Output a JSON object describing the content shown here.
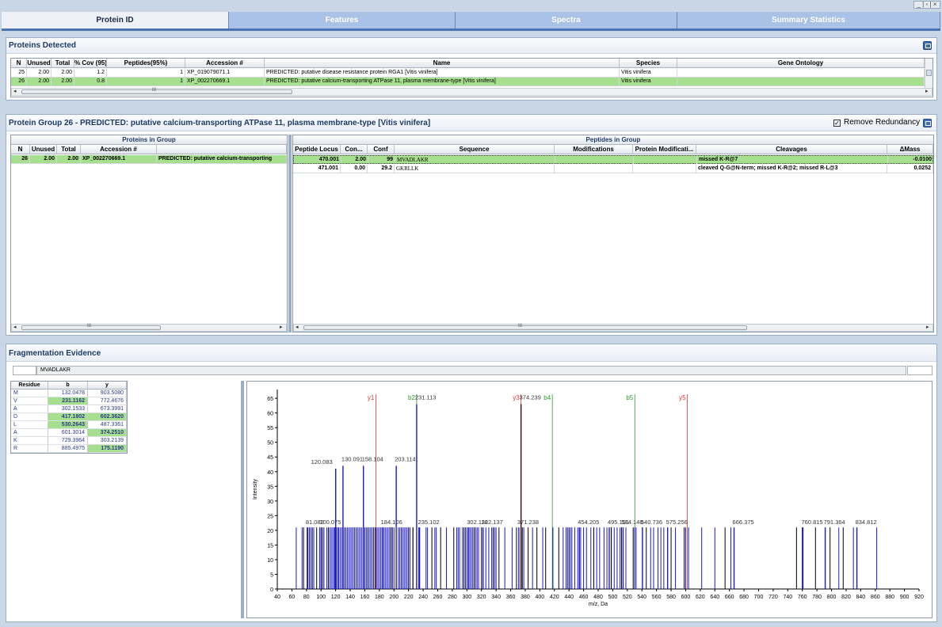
{
  "window": {
    "controls": "_ | ▫ | ×"
  },
  "tabs": [
    {
      "label": "Protein ID",
      "active": true
    },
    {
      "label": "Features",
      "active": false
    },
    {
      "label": "Spectra",
      "active": false
    },
    {
      "label": "Summary Statistics",
      "active": false
    }
  ],
  "proteins_detected": {
    "title": "Proteins Detected",
    "columns": [
      "N",
      "Unused",
      "Total",
      "% Cov (95)",
      "Peptides(95%)",
      "Accession #",
      "Name",
      "Species",
      "Gene Ontology"
    ],
    "rows": [
      {
        "n": "25",
        "unused": "2.00",
        "total": "2.00",
        "cov": "1.2",
        "peptides": "1",
        "accession": "XP_019079071.1",
        "name": "PREDICTED: putative disease resistance protein RGA1 [Vitis vinifera]",
        "species": "Vitis vinifera",
        "go": "",
        "selected": false
      },
      {
        "n": "26",
        "unused": "2.00",
        "total": "2.00",
        "cov": "0.8",
        "peptides": "1",
        "accession": "XP_002270669.1",
        "name": "PREDICTED: putative calcium-transporting ATPase 11, plasma membrane-type [Vitis vinifera]",
        "species": "Vitis vinifera",
        "go": "",
        "selected": true
      }
    ],
    "scroll_marker": "III"
  },
  "protein_group": {
    "title": "Protein Group 26 - PREDICTED: putative calcium-transporting ATPase 11, plasma membrane-type [Vitis vinifera]",
    "remove_redundancy_label": "Remove Redundancy",
    "remove_redundancy_checked": true,
    "proteins_in_group": {
      "header": "Proteins in Group",
      "columns": [
        "N",
        "Unused",
        "Total",
        "Accession #",
        ""
      ],
      "rows": [
        {
          "n": "26",
          "unused": "2.00",
          "total": "2.00",
          "accession": "XP_002270669.1",
          "name": "PREDICTED: putative calcium-transporting"
        }
      ],
      "scroll_marker": "III"
    },
    "peptides_in_group": {
      "header": "Peptides in Group",
      "columns": [
        "Peptide Locus",
        "Con...",
        "Conf",
        "Sequence",
        "Modifications",
        "Protein Modificati...",
        "Cleavages",
        "ΔMass"
      ],
      "rows": [
        {
          "locus": "470.001",
          "contrib": "2.00",
          "conf": "99",
          "sequence": "MVADLAKR",
          "mods": "",
          "protmods": "",
          "cleavages": "missed K-R@7",
          "dmass": "-0.0100",
          "selected": true
        },
        {
          "locus": "471.001",
          "contrib": "0.00",
          "conf": "29.2",
          "sequence": "GKRLLK",
          "mods": "",
          "protmods": "",
          "cleavages": "cleaved Q-G@N-term; missed K-R@2; missed R-L@3",
          "dmass": "0.0252",
          "selected": false
        }
      ],
      "scroll_marker": "III"
    }
  },
  "fragmentation": {
    "title": "Fragmentation Evidence",
    "sequence": "MVADLAKR",
    "table": {
      "columns": [
        "Residue",
        "b",
        "y"
      ],
      "rows": [
        {
          "residue": "M",
          "b": "132.0478",
          "y": "903.5080",
          "b_hl": false,
          "y_hl": false
        },
        {
          "residue": "V",
          "b": "231.1162",
          "y": "772.4676",
          "b_hl": true,
          "y_hl": false
        },
        {
          "residue": "A",
          "b": "302.1533",
          "y": "673.3991",
          "b_hl": false,
          "y_hl": false
        },
        {
          "residue": "D",
          "b": "417.1802",
          "y": "602.3620",
          "b_hl": true,
          "y_hl": true
        },
        {
          "residue": "L",
          "b": "530.2643",
          "y": "487.3361",
          "b_hl": true,
          "y_hl": false
        },
        {
          "residue": "A",
          "b": "601.3014",
          "y": "374.2510",
          "b_hl": false,
          "y_hl": true
        },
        {
          "residue": "K",
          "b": "729.3964",
          "y": "303.2139",
          "b_hl": false,
          "y_hl": false
        },
        {
          "residue": "R",
          "b": "885.4975",
          "y": "175.1190",
          "b_hl": false,
          "y_hl": true
        }
      ]
    }
  },
  "chart_data": {
    "type": "bar",
    "xlabel": "m/z, Da",
    "ylabel": "Intensity",
    "xlim": [
      40,
      920
    ],
    "ylim": [
      0,
      68
    ],
    "xticks": [
      40,
      60,
      80,
      100,
      120,
      140,
      160,
      180,
      200,
      220,
      240,
      260,
      280,
      300,
      320,
      340,
      360,
      380,
      400,
      420,
      440,
      460,
      480,
      500,
      520,
      540,
      560,
      580,
      600,
      620,
      640,
      660,
      680,
      700,
      720,
      740,
      760,
      780,
      800,
      820,
      840,
      860,
      880,
      900,
      920
    ],
    "yticks": [
      0,
      5,
      10,
      15,
      20,
      25,
      30,
      35,
      40,
      45,
      50,
      55,
      60,
      65
    ],
    "colors": {
      "peak": "#1a1acc",
      "y_ion": "#e03030",
      "b_ion": "#2a9a2a",
      "unmatched": "#000000"
    },
    "labeled_peaks": [
      {
        "mz": 81.083,
        "intensity": 21,
        "label": "81.083"
      },
      {
        "mz": 100.075,
        "intensity": 21,
        "label": "100.075"
      },
      {
        "mz": 120.083,
        "intensity": 41,
        "label": "120.083"
      },
      {
        "mz": 130.091,
        "intensity": 42,
        "label": "130.091"
      },
      {
        "mz": 158.104,
        "intensity": 42,
        "label": "158.104"
      },
      {
        "mz": 184.106,
        "intensity": 21,
        "label": "184.106"
      },
      {
        "mz": 203.114,
        "intensity": 42,
        "label": "203.114"
      },
      {
        "mz": 231.113,
        "intensity": 63,
        "label": "231.113"
      },
      {
        "mz": 235.102,
        "intensity": 21,
        "label": "235.102"
      },
      {
        "mz": 302.116,
        "intensity": 21,
        "label": "302.116"
      },
      {
        "mz": 322.137,
        "intensity": 21,
        "label": "322.137"
      },
      {
        "mz": 371.238,
        "intensity": 21,
        "label": "371.238"
      },
      {
        "mz": 374.239,
        "intensity": 63,
        "label": "374.239"
      },
      {
        "mz": 454.205,
        "intensity": 21,
        "label": "454.205"
      },
      {
        "mz": 495.191,
        "intensity": 21,
        "label": "495.191"
      },
      {
        "mz": 514.148,
        "intensity": 21,
        "label": "514.148"
      },
      {
        "mz": 540.736,
        "intensity": 21,
        "label": "540.736"
      },
      {
        "mz": 575.256,
        "intensity": 21,
        "label": "575.256"
      },
      {
        "mz": 666.375,
        "intensity": 21,
        "label": "666.375"
      },
      {
        "mz": 760.815,
        "intensity": 21,
        "label": "760.815"
      },
      {
        "mz": 791.364,
        "intensity": 21,
        "label": "791.364"
      },
      {
        "mz": 834.812,
        "intensity": 21,
        "label": "834.812"
      }
    ],
    "ion_markers": [
      {
        "label": "y1",
        "mz": 175.119,
        "kind": "y"
      },
      {
        "label": "b2",
        "mz": 231.116,
        "kind": "b"
      },
      {
        "label": "y3",
        "mz": 374.251,
        "kind": "y"
      },
      {
        "label": "b4",
        "mz": 417.18,
        "kind": "b"
      },
      {
        "label": "b5",
        "mz": 530.264,
        "kind": "b"
      },
      {
        "label": "y5",
        "mz": 602.362,
        "kind": "y"
      }
    ],
    "minor_peaks_blue": [
      66,
      74,
      82,
      84,
      86,
      90,
      98,
      104,
      108,
      112,
      114,
      116,
      118,
      119,
      121,
      123,
      124,
      126,
      128,
      132,
      134,
      136,
      138,
      140,
      142,
      144,
      146,
      148,
      150,
      152,
      154,
      156,
      160,
      162,
      166,
      168,
      170,
      172,
      176,
      178,
      180,
      182,
      186,
      188,
      190,
      192,
      194,
      196,
      198,
      200,
      206,
      208,
      210,
      212,
      214,
      216,
      218,
      222,
      226,
      234,
      244,
      246,
      256,
      258,
      272,
      286,
      288,
      290,
      294,
      298,
      300,
      304,
      306,
      308,
      312,
      314,
      316,
      326,
      330,
      334,
      338,
      340,
      352,
      362,
      378,
      390,
      404,
      418,
      432,
      436,
      438,
      442,
      444,
      448,
      452,
      456,
      460,
      464,
      470,
      474,
      478,
      482,
      488,
      492,
      498,
      502,
      506,
      510,
      518,
      530,
      532,
      552,
      556,
      562,
      566,
      570,
      586,
      600,
      604,
      622,
      640,
      662,
      810,
      830,
      862
    ],
    "minor_peaks_black": [
      76,
      88,
      94,
      102,
      110,
      130,
      164,
      174,
      196,
      220,
      226,
      252,
      264,
      282,
      296,
      310,
      320,
      336,
      344,
      368,
      376,
      384,
      396,
      408,
      426,
      440,
      474,
      498,
      512,
      528,
      546,
      580,
      598,
      654,
      752,
      760,
      778,
      798,
      816
    ]
  }
}
